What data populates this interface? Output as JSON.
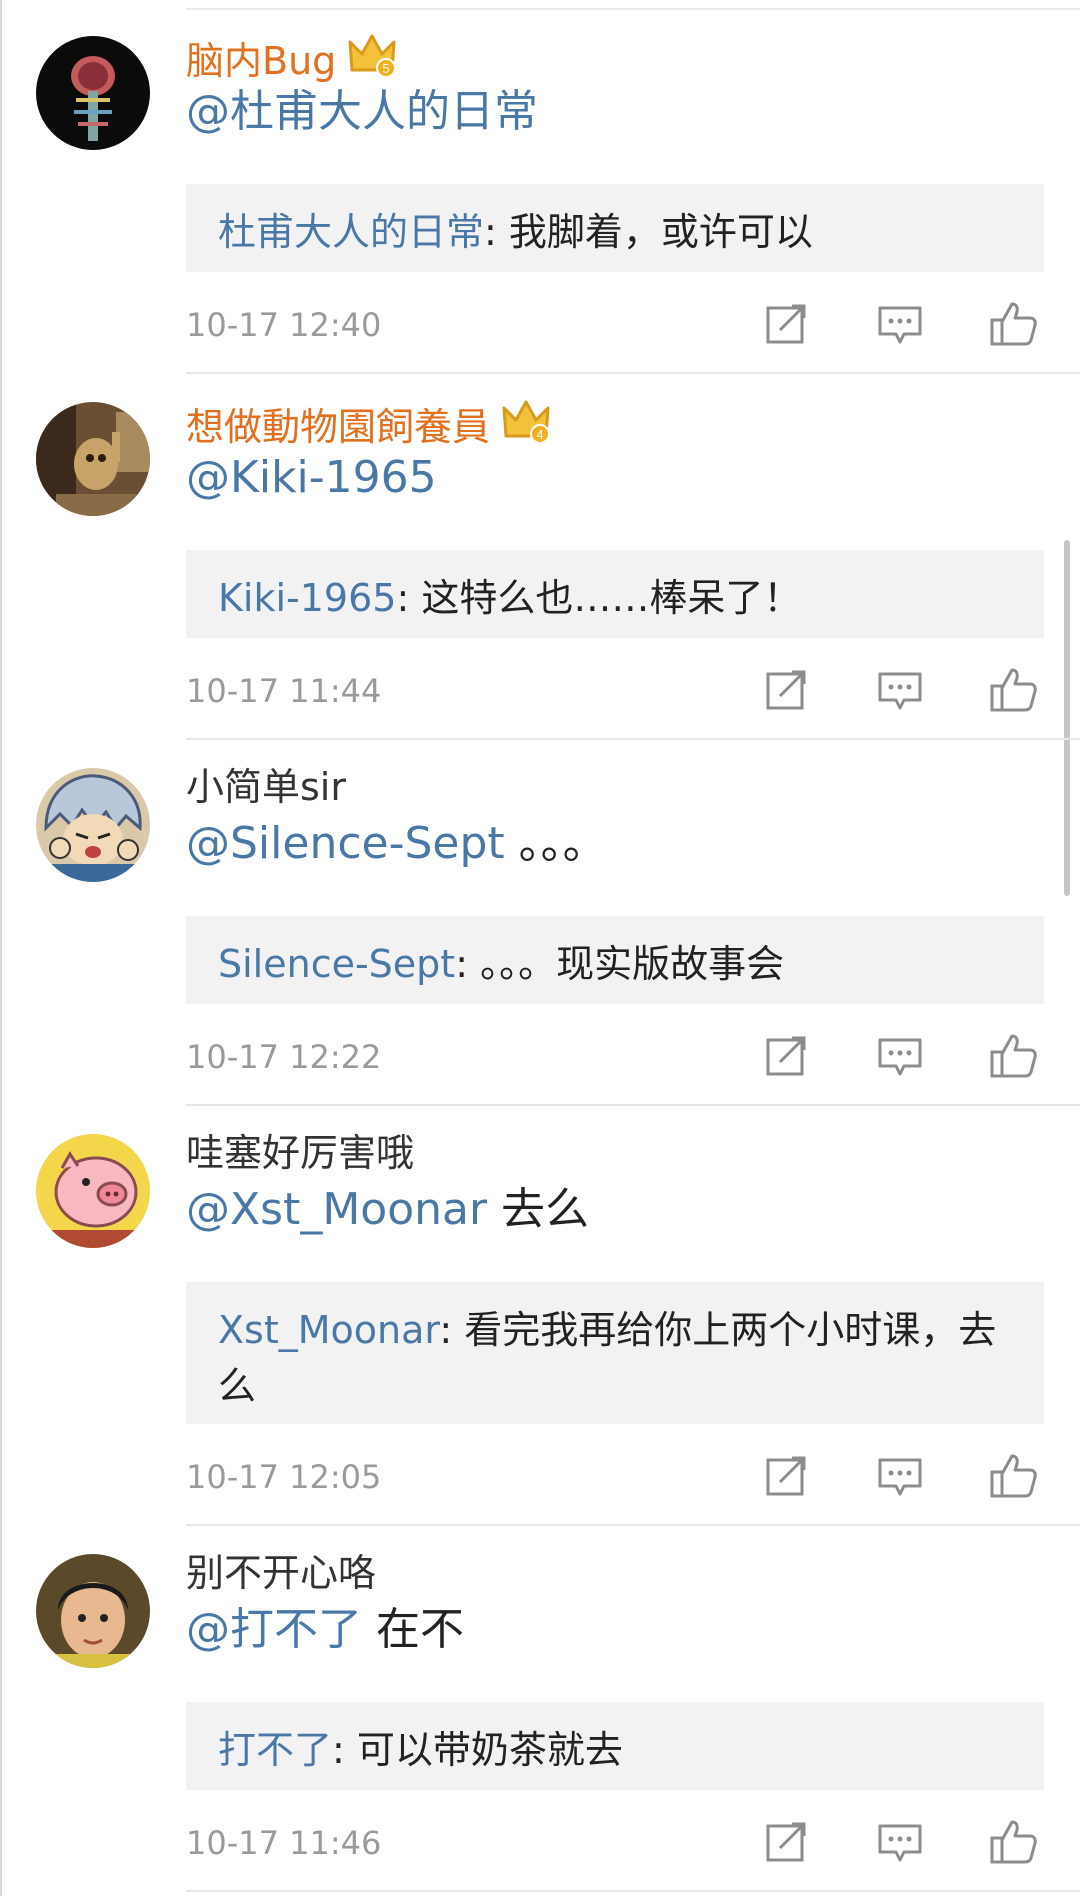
{
  "comments": [
    {
      "username": "脑内Bug",
      "vip_level": "5",
      "mention": "@杜甫大人的日常",
      "reply_text": "",
      "quote_name": "杜甫大人的日常",
      "quote_text": ": 我脚着，或许可以",
      "time": "10-17 12:40"
    },
    {
      "username": "想做動物園飼養員",
      "vip_level": "4",
      "mention": "@Kiki-1965",
      "reply_text": "",
      "quote_name": "Kiki-1965",
      "quote_text": ": 这特么也……棒呆了！",
      "time": "10-17 11:44"
    },
    {
      "username": "小简单sir",
      "mention": "@Silence-Sept",
      "reply_text": " 。。。",
      "quote_name": "Silence-Sept",
      "quote_text": ": 。。。现实版故事会",
      "time": "10-17 12:22"
    },
    {
      "username": "哇塞好厉害哦",
      "mention": "@Xst_Moonar",
      "reply_text": " 去么",
      "quote_name": "Xst_Moonar",
      "quote_text": ": 看完我再给你上两个小时课，去么",
      "time": "10-17 12:05"
    },
    {
      "username": "别不开心咯",
      "mention": "@打不了",
      "reply_text": " 在不",
      "quote_name": "打不了",
      "quote_text": ": 可以带奶茶就去",
      "time": "10-17 11:46"
    }
  ],
  "icons": {
    "share": "share-icon",
    "comment": "comment-icon",
    "like": "thumbs-up-icon"
  },
  "colors": {
    "vip_name": "#e2701f",
    "mention": "#4a78a6",
    "quote_bg": "#f2f2f2",
    "time": "#9a9a9a"
  }
}
